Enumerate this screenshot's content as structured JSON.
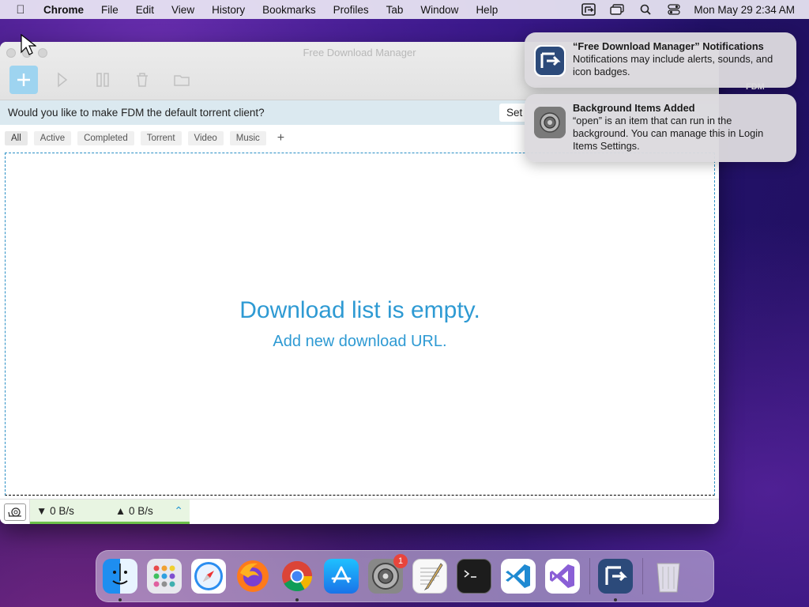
{
  "menubar": {
    "app_name": "Chrome",
    "items": [
      "File",
      "Edit",
      "View",
      "History",
      "Bookmarks",
      "Profiles",
      "Tab",
      "Window",
      "Help"
    ],
    "clock": "Mon May 29  2:34 AM"
  },
  "desktop": {
    "fdm_icon_label": "FDM"
  },
  "window": {
    "title": "Free Download Manager",
    "torrent_prompt": "Would you like to make FDM the default torrent client?",
    "set_button": "Set",
    "filters": [
      "All",
      "Active",
      "Completed",
      "Torrent",
      "Video",
      "Music"
    ],
    "add_filter": "+",
    "empty_title": "Download list is empty.",
    "empty_subtitle": "Add new download URL.",
    "download_speed": "0 B/s",
    "upload_speed": "0 B/s"
  },
  "notifications": [
    {
      "title": "“Free Download Manager” Notifications",
      "body": "Notifications may include alerts, sounds, and icon badges.",
      "icon": "fdm-icon"
    },
    {
      "title": "Background Items Added",
      "body": "“open” is an item that can run in the background. You can manage this in Login Items Settings.",
      "icon": "system-settings-icon"
    }
  ],
  "dock": {
    "apps": [
      "finder",
      "launchpad",
      "safari",
      "firefox",
      "chrome",
      "app-store",
      "system-settings",
      "textedit",
      "terminal",
      "vscode",
      "visual-studio",
      "free-download-manager",
      "trash"
    ],
    "system_settings_badge": "1"
  },
  "colors": {
    "accent": "#2e9ad3",
    "speed_bar": "#6cc04a",
    "torrent_bar": "#dbe9f0"
  }
}
